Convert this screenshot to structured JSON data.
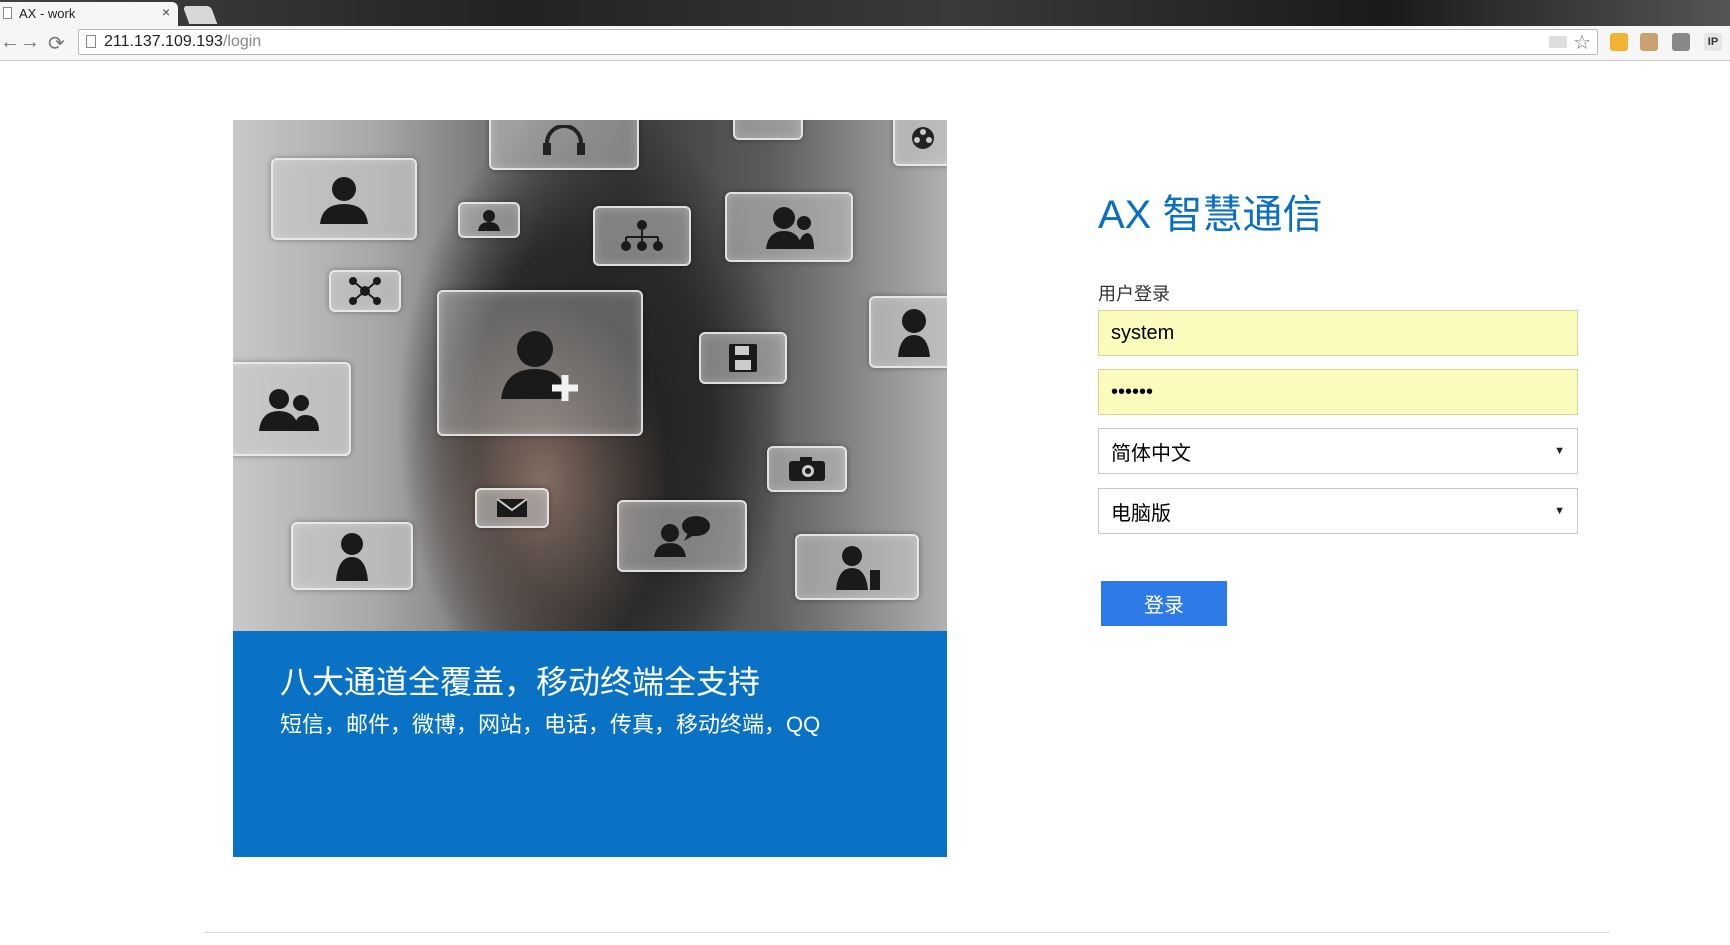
{
  "browser": {
    "tab_title": "AX - work",
    "tab_close": "×",
    "url_host": "211.137.109.193",
    "url_path": "/login",
    "nav": {
      "back": "←",
      "forward": "→",
      "reload": "⟳"
    },
    "star": "☆",
    "extensions": [
      "IP"
    ]
  },
  "hero": {
    "banner_title": "八大通道全覆盖，移动终端全支持",
    "banner_subtitle": "短信，邮件，微博，网站，电话，传真，移动终端，QQ",
    "banner_color": "#0a72c4"
  },
  "login": {
    "app_title": "AX 智慧通信",
    "section_label": "用户登录",
    "username_value": "system",
    "password_value": "••••••",
    "language_selected": "简体中文",
    "version_selected": "电脑版",
    "submit_label": "登录",
    "accent_color": "#0a6fc2",
    "button_color": "#2d7ae8",
    "input_bg": "#fbfcbc"
  }
}
